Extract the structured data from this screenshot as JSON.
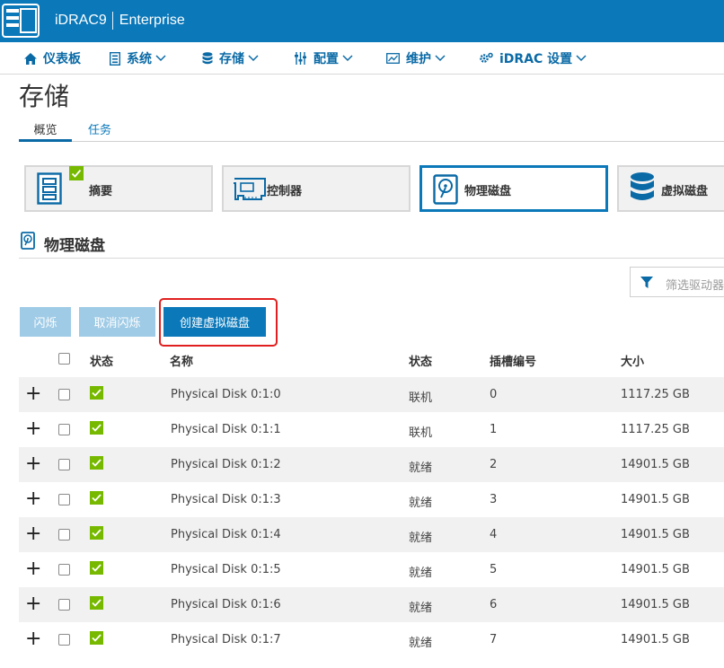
{
  "header": {
    "product": "iDRAC9",
    "edition": "Enterprise",
    "logo_icon": "server-logo-icon",
    "bar_color": "#0a78b9"
  },
  "menu": {
    "items": [
      {
        "label": "仪表板",
        "icon": "home-icon",
        "has_dropdown": false
      },
      {
        "label": "系统",
        "icon": "server-icon",
        "has_dropdown": true
      },
      {
        "label": "存储",
        "icon": "database-icon",
        "has_dropdown": true
      },
      {
        "label": "配置",
        "icon": "sliders-icon",
        "has_dropdown": true
      },
      {
        "label": "维护",
        "icon": "monitor-icon",
        "has_dropdown": true
      },
      {
        "label": "iDRAC 设置",
        "icon": "gear-icon",
        "has_dropdown": true
      }
    ]
  },
  "page": {
    "title": "存储",
    "tabs": [
      {
        "label": "概览",
        "active": true
      },
      {
        "label": "任务",
        "active": false
      }
    ]
  },
  "tiles": [
    {
      "label": "摘要",
      "icon": "summary-icon",
      "selected": false,
      "status": "ok"
    },
    {
      "label": "控制器",
      "icon": "controller-card-icon",
      "selected": false
    },
    {
      "label": "物理磁盘",
      "icon": "physical-disk-icon",
      "selected": true
    },
    {
      "label": "虚拟磁盘",
      "icon": "virtual-disk-icon",
      "selected": false
    }
  ],
  "section": {
    "title": "物理磁盘",
    "filter_placeholder": "筛选驱动器"
  },
  "actions": {
    "blink": "闪烁",
    "unblink": "取消闪烁",
    "create_vd": "创建虚拟磁盘"
  },
  "table": {
    "headers": {
      "status_icon": "状态",
      "name": "名称",
      "state": "状态",
      "slot": "插槽编号",
      "size": "大小"
    },
    "rows": [
      {
        "name": "Physical Disk 0:1:0",
        "state": "联机",
        "slot": "0",
        "size": "1117.25 GB"
      },
      {
        "name": "Physical Disk 0:1:1",
        "state": "联机",
        "slot": "1",
        "size": "1117.25 GB"
      },
      {
        "name": "Physical Disk 0:1:2",
        "state": "就绪",
        "slot": "2",
        "size": "14901.5 GB"
      },
      {
        "name": "Physical Disk 0:1:3",
        "state": "就绪",
        "slot": "3",
        "size": "14901.5 GB"
      },
      {
        "name": "Physical Disk 0:1:4",
        "state": "就绪",
        "slot": "4",
        "size": "14901.5 GB"
      },
      {
        "name": "Physical Disk 0:1:5",
        "state": "就绪",
        "slot": "5",
        "size": "14901.5 GB"
      },
      {
        "name": "Physical Disk 0:1:6",
        "state": "就绪",
        "slot": "6",
        "size": "14901.5 GB"
      },
      {
        "name": "Physical Disk 0:1:7",
        "state": "就绪",
        "slot": "7",
        "size": "14901.5 GB"
      }
    ]
  },
  "colors": {
    "primary": "#0a78b9",
    "link": "#0a6aa6",
    "ok_green": "#76b900",
    "highlight_red": "#e02020"
  }
}
